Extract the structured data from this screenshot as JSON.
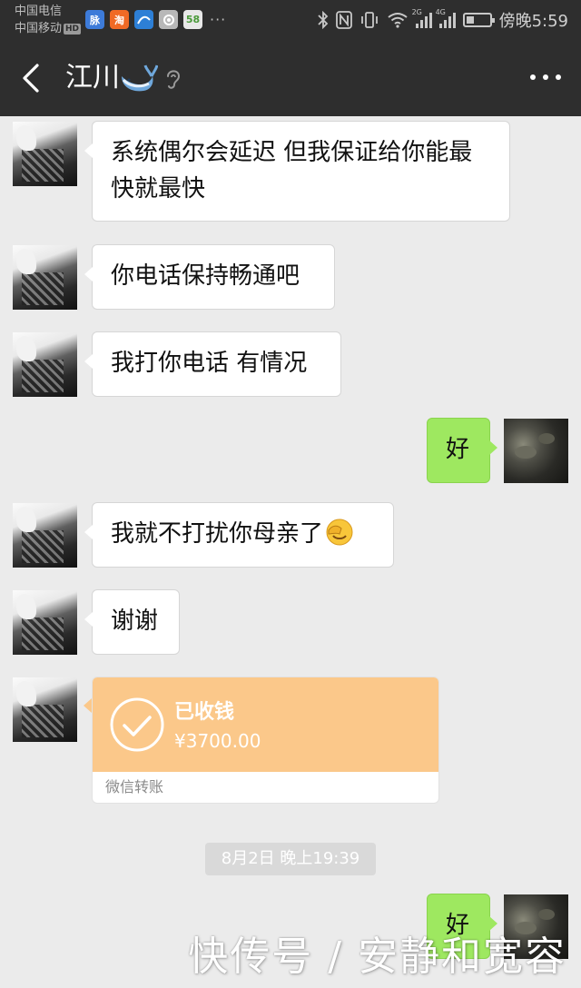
{
  "status_bar": {
    "carrier_1": "中国电信",
    "carrier_2": "中国移动",
    "hd_label": "HD",
    "app_icons": [
      {
        "name": "maimai-icon",
        "label": "脉",
        "color": "#3d7bd9"
      },
      {
        "name": "taobao-icon",
        "label": "淘",
        "color": "#f06a26"
      },
      {
        "name": "zhifubao-icon",
        "label": "",
        "color": "#2d7fd6"
      },
      {
        "name": "qiantu-icon",
        "label": "",
        "color": "#b8b8b8"
      },
      {
        "name": "58-icon",
        "label": "58",
        "color": "#e8e8e8"
      }
    ],
    "signal_1_tag": "2G",
    "signal_2_tag": "4G",
    "time": "傍晚5:59"
  },
  "header": {
    "contact_name": "江川"
  },
  "messages": [
    {
      "from": "contact",
      "text": "系统偶尔会延迟 但我保证给你能最快就最快"
    },
    {
      "from": "contact",
      "text": "你电话保持畅通吧"
    },
    {
      "from": "contact",
      "text": "我打你电话 有情况"
    },
    {
      "from": "me",
      "text": "好"
    },
    {
      "from": "contact",
      "text": "我就不打扰你母亲了",
      "emoji": "facepalm-emoji"
    },
    {
      "from": "contact",
      "text": "谢谢"
    },
    {
      "from": "me",
      "text": "好"
    }
  ],
  "transfer": {
    "status": "已收钱",
    "amount": "¥3700.00",
    "footer": "微信转账",
    "color": "#fbc88a"
  },
  "timestamp": "8月2日 晚上19:39",
  "watermark": "快传号 / 安静和宽容",
  "colors": {
    "header_bg": "#2e2e2e",
    "chat_bg": "#ebebeb",
    "my_bubble": "#9ee860",
    "their_bubble": "#ffffff"
  }
}
